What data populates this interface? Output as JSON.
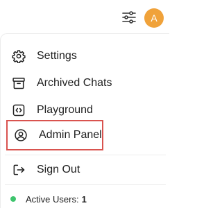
{
  "header": {
    "controls_icon": "sliders-icon",
    "avatar_initial": "A",
    "avatar_color": "#f0a23a"
  },
  "menu": {
    "items": [
      {
        "label": "Settings",
        "icon": "gear-icon"
      },
      {
        "label": "Archived Chats",
        "icon": "archive-icon"
      },
      {
        "label": "Playground",
        "icon": "code-icon"
      },
      {
        "label": "Admin Panel",
        "icon": "user-circle-icon",
        "highlighted": true,
        "highlight_color": "#d9534f"
      },
      {
        "label": "Sign Out",
        "icon": "sign-out-icon"
      }
    ]
  },
  "status": {
    "label": "Active Users:",
    "count": "1",
    "dot_color": "#3ec46d"
  }
}
